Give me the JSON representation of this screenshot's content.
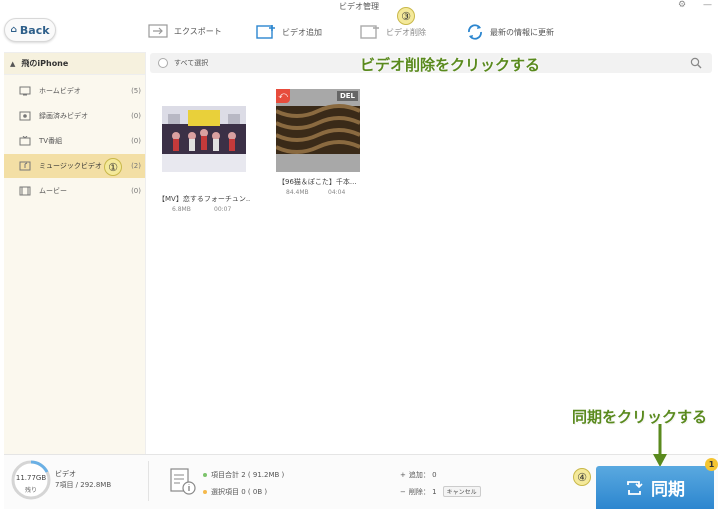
{
  "window": {
    "title": "ビデオ管理",
    "controls": [
      "⚙",
      "—"
    ]
  },
  "back_label": "Back",
  "toolbar": {
    "export": "エクスポート",
    "add_video": "ビデオ追加",
    "delete_video": "ビデオ削除",
    "refresh": "最新の情報に更新"
  },
  "markers": {
    "m1": "①",
    "m3": "③",
    "m4": "④"
  },
  "annotations": {
    "delete_hint": "ビデオ削除をクリックする",
    "sync_hint": "同期をクリックする"
  },
  "sidebar": {
    "device": "飛のiPhone",
    "items": [
      {
        "label": "ホームビデオ",
        "count": "(5)",
        "icon": "home-video-icon"
      },
      {
        "label": "録画済みビデオ",
        "count": "(0)",
        "icon": "recorded-video-icon"
      },
      {
        "label": "TV番組",
        "count": "(0)",
        "icon": "tv-icon"
      },
      {
        "label": "ミュージックビデオ",
        "count": "(2)",
        "icon": "music-video-icon"
      },
      {
        "label": "ムービー",
        "count": "(0)",
        "icon": "film-icon"
      }
    ]
  },
  "list": {
    "select_all": "すべて選択",
    "items": [
      {
        "title": "【MV】恋するフォーチュン...",
        "size": "6.8MB",
        "duration": "00:07"
      },
      {
        "title": "【96猫＆ぽこた】千本...",
        "size": "84.4MB",
        "duration": "04:04",
        "badge": "DEL",
        "undo": "⤺"
      }
    ]
  },
  "storage": {
    "capacity": "11.77GB",
    "remaining": "残り",
    "type": "ビデオ",
    "detail": "7項目 / 292.8MB"
  },
  "stats": {
    "total": "項目合計 2 ( 91.2MB )",
    "selected": "選択項目 0 ( 0B )",
    "add": "追加： 0",
    "delete": "削除： 1",
    "cancel": "キャンセル"
  },
  "sync": {
    "label": "同期",
    "badge": "1"
  },
  "colors": {
    "accent": "#2c86cf",
    "sidebar_active": "#f3dfa5",
    "annotation": "#5a8a1e",
    "delete_badge": "#e74c3c"
  }
}
